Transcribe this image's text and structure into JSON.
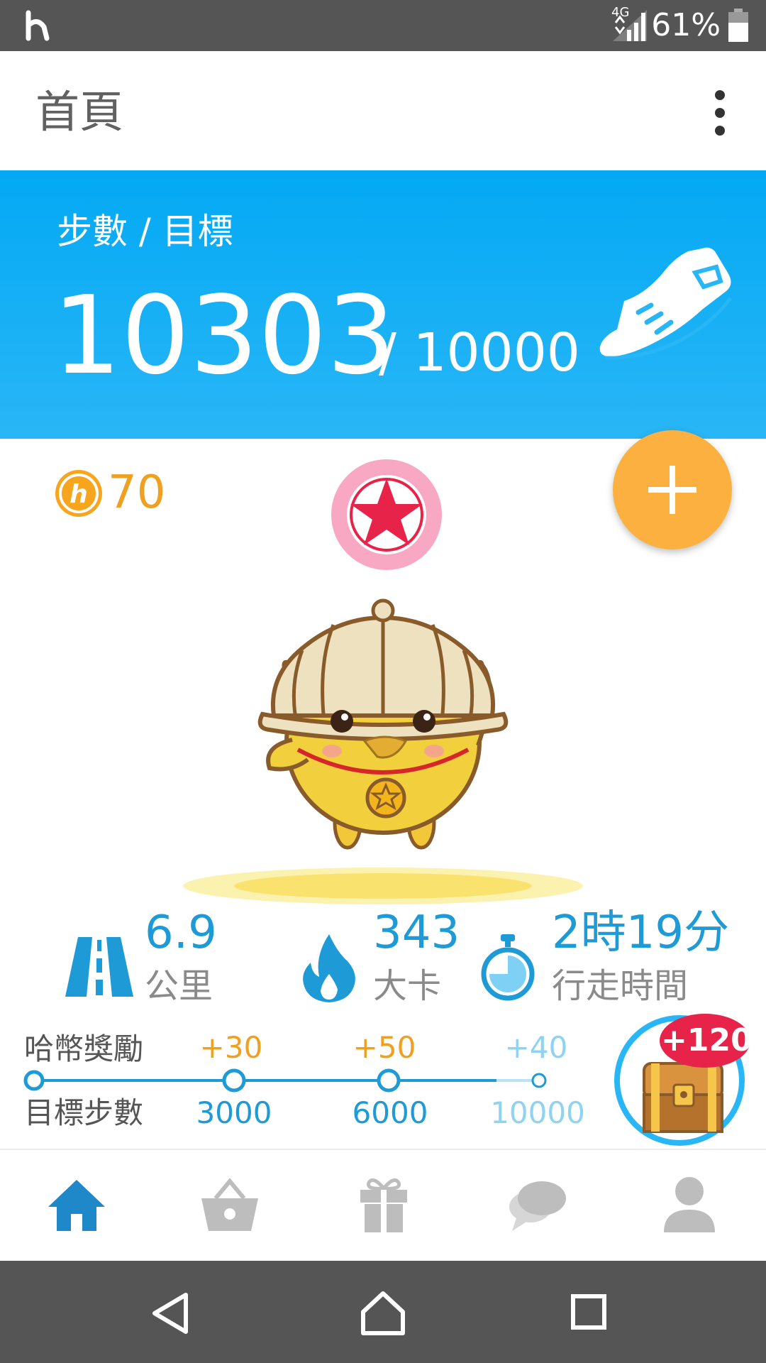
{
  "status_bar": {
    "network": "4G",
    "battery": "61%"
  },
  "app_bar": {
    "title": "首頁",
    "more_icon": "more-vert-icon"
  },
  "steps": {
    "label": "步數 / 目標",
    "current": "10303",
    "goal": "/ 10000",
    "icon": "sneaker-icon"
  },
  "coins": {
    "icon": "coin-icon",
    "value": "70"
  },
  "fab": {
    "icon": "plus-icon"
  },
  "badge": {
    "icon": "star-badge-icon"
  },
  "stats": [
    {
      "icon": "road-icon",
      "value": "6.9",
      "label": "公里"
    },
    {
      "icon": "flame-icon",
      "value": "343",
      "label": "大卡"
    },
    {
      "icon": "stopwatch-icon",
      "value": "2時19分",
      "label": "行走時間"
    }
  ],
  "rewards": {
    "coin_label": "哈幣獎勵",
    "steps_label": "目標步數",
    "milestones": [
      {
        "reward": "+30",
        "steps": "3000"
      },
      {
        "reward": "+50",
        "steps": "6000"
      },
      {
        "reward": "+40",
        "steps": "10000"
      }
    ],
    "chest": {
      "icon": "treasure-chest-icon",
      "badge": "+120"
    }
  },
  "bottom_nav": [
    {
      "icon": "home-icon",
      "active": true
    },
    {
      "icon": "shopping-basket-icon",
      "active": false
    },
    {
      "icon": "gift-icon",
      "active": false
    },
    {
      "icon": "chat-icon",
      "active": false
    },
    {
      "icon": "person-icon",
      "active": false
    }
  ],
  "colors": {
    "accent_blue": "#03a9f4",
    "stat_blue": "#1e9ad6",
    "coin_orange": "#f0a020",
    "fab_orange": "#fbb040",
    "badge_red": "#e8234a",
    "badge_pink": "#f9a8c4"
  }
}
